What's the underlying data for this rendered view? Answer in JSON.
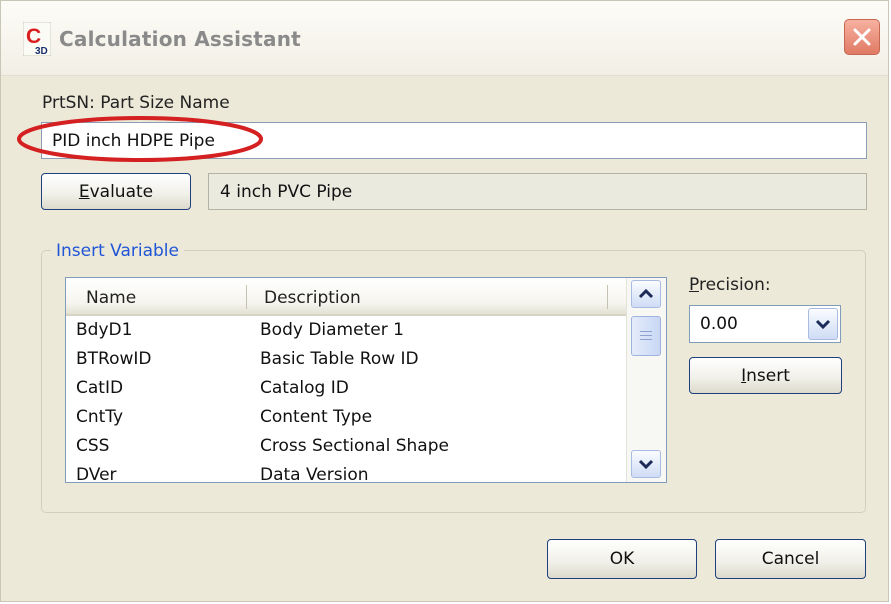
{
  "window": {
    "title": "Calculation Assistant",
    "icon_letter": "C",
    "icon_sub": "3D"
  },
  "expression": {
    "label": "PrtSN: Part Size Name",
    "value": "PID inch HDPE Pipe",
    "highlight_color": "#d42020"
  },
  "evaluate": {
    "button_label_u": "E",
    "button_label_rest": "valuate",
    "result": "4 inch PVC Pipe"
  },
  "insert_variable": {
    "title": "Insert Variable",
    "columns": [
      "Name",
      "Description"
    ],
    "rows": [
      {
        "name": "BdyD1",
        "description": "Body Diameter  1"
      },
      {
        "name": "BTRowID",
        "description": "Basic Table Row ID"
      },
      {
        "name": "CatID",
        "description": "Catalog ID"
      },
      {
        "name": "CntTy",
        "description": "Content Type"
      },
      {
        "name": "CSS",
        "description": "Cross Sectional Shape"
      },
      {
        "name": "DVer",
        "description": "Data Version"
      }
    ]
  },
  "precision": {
    "label_u": "P",
    "label_rest": "recision:",
    "value": "0.00"
  },
  "insert_button": {
    "label_u": "I",
    "label_rest": "nsert"
  },
  "footer": {
    "ok_label": "OK",
    "cancel_label": "Cancel"
  },
  "colors": {
    "dialog_bg": "#ece9d8",
    "group_title": "#1f55d6",
    "close_button": "#e07a64"
  }
}
